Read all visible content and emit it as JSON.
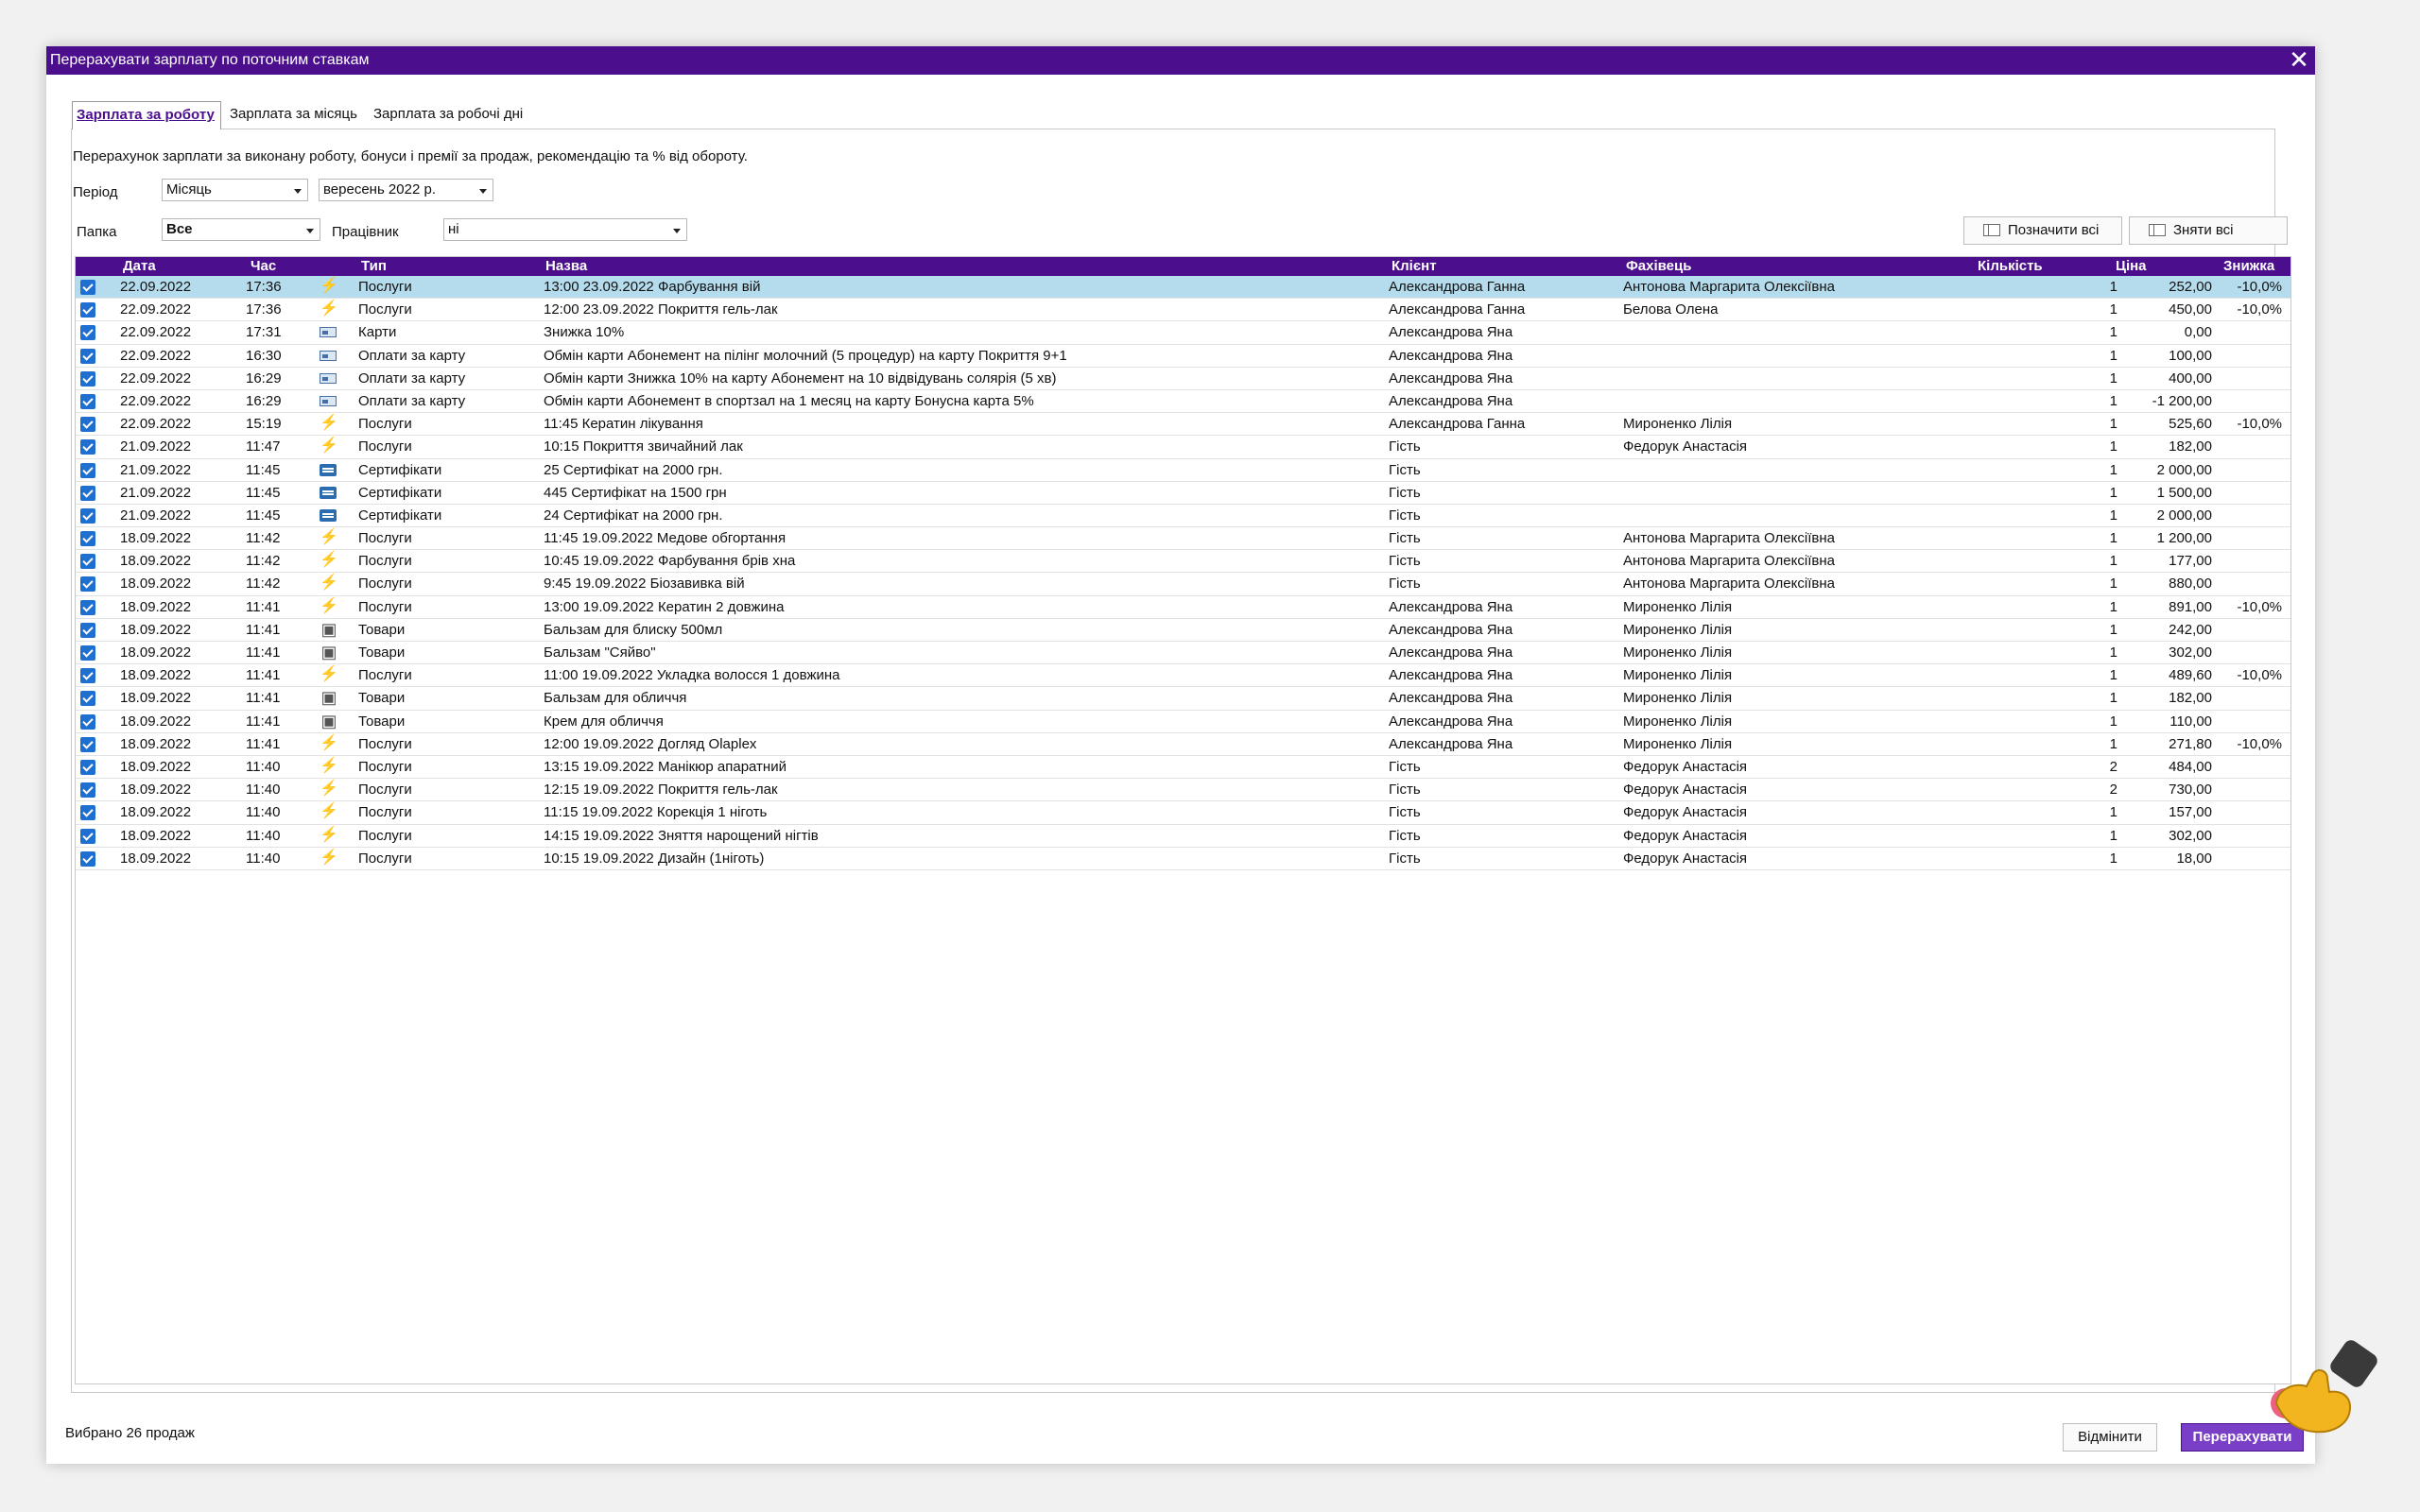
{
  "window": {
    "title": "Перерахувати зарплату по поточним ставкам",
    "close": "✕"
  },
  "tabs": [
    {
      "label": "Зарплата за роботу",
      "active": true
    },
    {
      "label": "Зарплата за місяць",
      "active": false
    },
    {
      "label": "Зарплата за робочі дні",
      "active": false
    }
  ],
  "description": "Перерахунок зарплати за виконану роботу, бонуси і премії за продаж, рекомендацію та % від обороту.",
  "filters": {
    "period_label": "Період",
    "period_value": "Місяць",
    "month_value": "вересень  2022 р.",
    "folder_label": "Папка",
    "folder_value": "Все",
    "employee_label": "Працівник",
    "employee_value": "ні"
  },
  "buttons": {
    "select_all": "Позначити всі",
    "deselect_all": "Зняти всі",
    "cancel": "Відмінити",
    "recalc": "Перерахувати"
  },
  "table": {
    "columns": [
      "Дата",
      "Час",
      "Тип",
      "Назва",
      "Клієнт",
      "Фахівець",
      "Кількість",
      "Ціна",
      "Знижка"
    ],
    "rows": [
      {
        "date": "22.09.2022",
        "time": "17:36",
        "icon": "lightning-icon",
        "type": "Послуги",
        "name": "13:00 23.09.2022 Фарбування вій",
        "client": "Александрова Ганна",
        "specialist": "Антонова Маргарита Олексіївна",
        "qty": "1",
        "price": "252,00",
        "discount": "-10,0%",
        "selected": true
      },
      {
        "date": "22.09.2022",
        "time": "17:36",
        "icon": "lightning-icon",
        "type": "Послуги",
        "name": "12:00 23.09.2022 Покриття гель-лак",
        "client": "Александрова Ганна",
        "specialist": "Белова Олена",
        "qty": "1",
        "price": "450,00",
        "discount": "-10,0%"
      },
      {
        "date": "22.09.2022",
        "time": "17:31",
        "icon": "card-icon",
        "type": "Карти",
        "name": "Знижка 10%",
        "client": "Александрова Яна",
        "specialist": "",
        "qty": "1",
        "price": "0,00",
        "discount": ""
      },
      {
        "date": "22.09.2022",
        "time": "16:30",
        "icon": "card-icon",
        "type": "Оплати за карту",
        "name": "Обмін карти Абонемент на пілінг молочний (5 процедур) на карту Покриття 9+1",
        "client": "Александрова Яна",
        "specialist": "",
        "qty": "1",
        "price": "100,00",
        "discount": ""
      },
      {
        "date": "22.09.2022",
        "time": "16:29",
        "icon": "card-icon",
        "type": "Оплати за карту",
        "name": "Обмін карти Знижка 10% на карту Абонемент на 10 відвідувань солярія (5 хв)",
        "client": "Александрова Яна",
        "specialist": "",
        "qty": "1",
        "price": "400,00",
        "discount": ""
      },
      {
        "date": "22.09.2022",
        "time": "16:29",
        "icon": "card-icon",
        "type": "Оплати за карту",
        "name": "Обмін карти Абонемент в спортзал на 1 месяц на карту Бонусна карта 5%",
        "client": "Александрова Яна",
        "specialist": "",
        "qty": "1",
        "price": "-1 200,00",
        "discount": ""
      },
      {
        "date": "22.09.2022",
        "time": "15:19",
        "icon": "lightning-icon",
        "type": "Послуги",
        "name": "11:45 Кератин лікування",
        "client": "Александрова Ганна",
        "specialist": "Мироненко Лілія",
        "qty": "1",
        "price": "525,60",
        "discount": "-10,0%"
      },
      {
        "date": "21.09.2022",
        "time": "11:47",
        "icon": "lightning-icon",
        "type": "Послуги",
        "name": "10:15 Покриття звичайний лак",
        "client": "Гість",
        "specialist": "Федорук Анастасія",
        "qty": "1",
        "price": "182,00",
        "discount": ""
      },
      {
        "date": "21.09.2022",
        "time": "11:45",
        "icon": "certificate-icon",
        "type": "Сертифікати",
        "name": "25 Сертифікат на 2000 грн.",
        "client": "Гість",
        "specialist": "",
        "qty": "1",
        "price": "2 000,00",
        "discount": ""
      },
      {
        "date": "21.09.2022",
        "time": "11:45",
        "icon": "certificate-icon",
        "type": "Сертифікати",
        "name": "445 Сертифікат на 1500 грн",
        "client": "Гість",
        "specialist": "",
        "qty": "1",
        "price": "1 500,00",
        "discount": ""
      },
      {
        "date": "21.09.2022",
        "time": "11:45",
        "icon": "certificate-icon",
        "type": "Сертифікати",
        "name": "24 Сертифікат на 2000 грн.",
        "client": "Гість",
        "specialist": "",
        "qty": "1",
        "price": "2 000,00",
        "discount": ""
      },
      {
        "date": "18.09.2022",
        "time": "11:42",
        "icon": "lightning-icon",
        "type": "Послуги",
        "name": "11:45 19.09.2022 Медове обгортання",
        "client": "Гість",
        "specialist": "Антонова Маргарита Олексіївна",
        "qty": "1",
        "price": "1 200,00",
        "discount": ""
      },
      {
        "date": "18.09.2022",
        "time": "11:42",
        "icon": "lightning-icon",
        "type": "Послуги",
        "name": "10:45 19.09.2022 Фарбування брів хна",
        "client": "Гість",
        "specialist": "Антонова Маргарита Олексіївна",
        "qty": "1",
        "price": "177,00",
        "discount": ""
      },
      {
        "date": "18.09.2022",
        "time": "11:42",
        "icon": "lightning-icon",
        "type": "Послуги",
        "name": "9:45 19.09.2022 Біозавивка вій",
        "client": "Гість",
        "specialist": "Антонова Маргарита Олексіївна",
        "qty": "1",
        "price": "880,00",
        "discount": ""
      },
      {
        "date": "18.09.2022",
        "time": "11:41",
        "icon": "lightning-icon",
        "type": "Послуги",
        "name": "13:00 19.09.2022 Кератин 2 довжина",
        "client": "Александрова Яна",
        "specialist": "Мироненко Лілія",
        "qty": "1",
        "price": "891,00",
        "discount": "-10,0%"
      },
      {
        "date": "18.09.2022",
        "time": "11:41",
        "icon": "box-icon",
        "type": "Товари",
        "name": "Бальзам для блиску 500мл",
        "client": "Александрова Яна",
        "specialist": "Мироненко Лілія",
        "qty": "1",
        "price": "242,00",
        "discount": ""
      },
      {
        "date": "18.09.2022",
        "time": "11:41",
        "icon": "box-icon",
        "type": "Товари",
        "name": "Бальзам \"Сяйво\"",
        "client": "Александрова Яна",
        "specialist": "Мироненко Лілія",
        "qty": "1",
        "price": "302,00",
        "discount": ""
      },
      {
        "date": "18.09.2022",
        "time": "11:41",
        "icon": "lightning-icon",
        "type": "Послуги",
        "name": "11:00 19.09.2022 Укладка волосся 1 довжина",
        "client": "Александрова Яна",
        "specialist": "Мироненко Лілія",
        "qty": "1",
        "price": "489,60",
        "discount": "-10,0%"
      },
      {
        "date": "18.09.2022",
        "time": "11:41",
        "icon": "box-icon",
        "type": "Товари",
        "name": "Бальзам для обличчя",
        "client": "Александрова Яна",
        "specialist": "Мироненко Лілія",
        "qty": "1",
        "price": "182,00",
        "discount": ""
      },
      {
        "date": "18.09.2022",
        "time": "11:41",
        "icon": "box-icon",
        "type": "Товари",
        "name": "Крем для обличчя",
        "client": "Александрова Яна",
        "specialist": "Мироненко Лілія",
        "qty": "1",
        "price": "110,00",
        "discount": ""
      },
      {
        "date": "18.09.2022",
        "time": "11:41",
        "icon": "lightning-icon",
        "type": "Послуги",
        "name": "12:00 19.09.2022 Догляд Olaplex",
        "client": "Александрова Яна",
        "specialist": "Мироненко Лілія",
        "qty": "1",
        "price": "271,80",
        "discount": "-10,0%"
      },
      {
        "date": "18.09.2022",
        "time": "11:40",
        "icon": "lightning-icon",
        "type": "Послуги",
        "name": "13:15 19.09.2022 Манікюр апаратний",
        "client": "Гість",
        "specialist": "Федорук Анастасія",
        "qty": "2",
        "price": "484,00",
        "discount": ""
      },
      {
        "date": "18.09.2022",
        "time": "11:40",
        "icon": "lightning-icon",
        "type": "Послуги",
        "name": "12:15 19.09.2022 Покриття гель-лак",
        "client": "Гість",
        "specialist": "Федорук Анастасія",
        "qty": "2",
        "price": "730,00",
        "discount": ""
      },
      {
        "date": "18.09.2022",
        "time": "11:40",
        "icon": "lightning-icon",
        "type": "Послуги",
        "name": "11:15 19.09.2022 Корекція 1 ніготь",
        "client": "Гість",
        "specialist": "Федорук Анастасія",
        "qty": "1",
        "price": "157,00",
        "discount": ""
      },
      {
        "date": "18.09.2022",
        "time": "11:40",
        "icon": "lightning-icon",
        "type": "Послуги",
        "name": "14:15 19.09.2022 Зняття нарощений нігтів",
        "client": "Гість",
        "specialist": "Федорук Анастасія",
        "qty": "1",
        "price": "302,00",
        "discount": ""
      },
      {
        "date": "18.09.2022",
        "time": "11:40",
        "icon": "lightning-icon",
        "type": "Послуги",
        "name": "10:15 19.09.2022 Дизайн (1ніготь)",
        "client": "Гість",
        "specialist": "Федорук Анастасія",
        "qty": "1",
        "price": "18,00",
        "discount": ""
      }
    ]
  },
  "status": "Вибрано 26 продаж",
  "colors": {
    "accent": "#4b0e8c",
    "selected_row": "#b5dced",
    "checkbox": "#1f6fd1"
  }
}
